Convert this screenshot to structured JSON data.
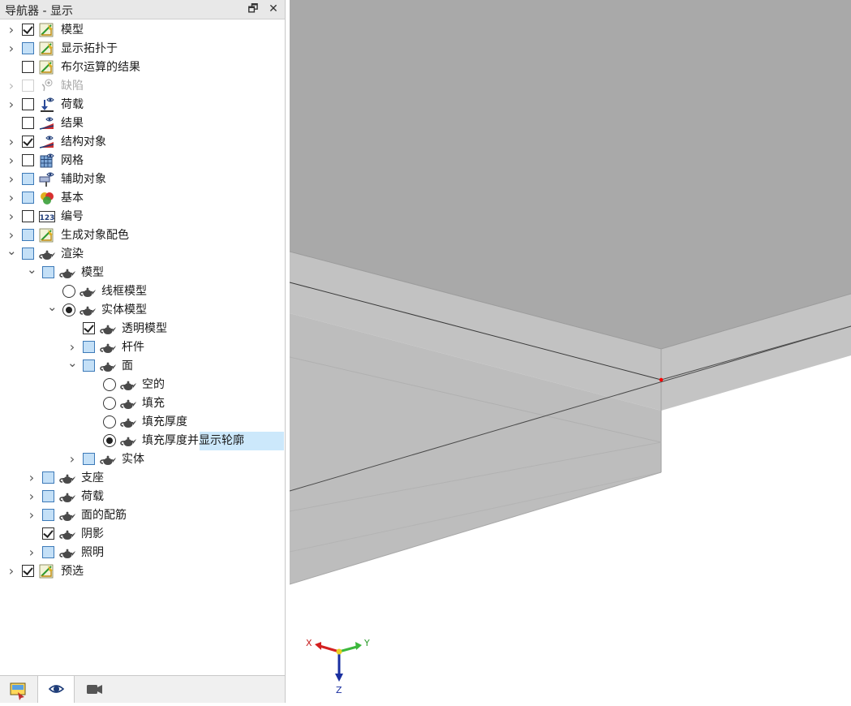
{
  "navigator": {
    "title": "导航器 - 显示",
    "pin_symbol": "🗗",
    "close_symbol": "✕"
  },
  "tree": [
    {
      "label": "模型",
      "depth": 0,
      "expander": "collapsed",
      "control": "checkbox",
      "state": "checked",
      "icon": "model-icon"
    },
    {
      "label": "显示拓扑于",
      "depth": 0,
      "expander": "collapsed",
      "control": "checkbox",
      "state": "partial",
      "icon": "model-icon"
    },
    {
      "label": "布尔运算的结果",
      "depth": 0,
      "expander": "none",
      "control": "checkbox",
      "state": "unchecked",
      "icon": "model-icon"
    },
    {
      "label": "缺陷",
      "depth": 0,
      "expander": "collapsed",
      "control": "checkbox",
      "state": "disabled",
      "icon": "imperfection-icon"
    },
    {
      "label": "荷载",
      "depth": 0,
      "expander": "collapsed",
      "control": "checkbox",
      "state": "unchecked",
      "icon": "load-icon"
    },
    {
      "label": "结果",
      "depth": 0,
      "expander": "none",
      "control": "checkbox",
      "state": "unchecked",
      "icon": "result-icon"
    },
    {
      "label": "结构对象",
      "depth": 0,
      "expander": "collapsed",
      "control": "checkbox",
      "state": "checked",
      "icon": "result-icon"
    },
    {
      "label": "网格",
      "depth": 0,
      "expander": "collapsed",
      "control": "checkbox",
      "state": "unchecked",
      "icon": "grid-icon"
    },
    {
      "label": "辅助对象",
      "depth": 0,
      "expander": "collapsed",
      "control": "checkbox",
      "state": "partial",
      "icon": "guide-object-icon"
    },
    {
      "label": "基本",
      "depth": 0,
      "expander": "collapsed",
      "control": "checkbox",
      "state": "partial",
      "icon": "basic-icon"
    },
    {
      "label": "编号",
      "depth": 0,
      "expander": "collapsed",
      "control": "checkbox",
      "state": "unchecked",
      "icon": "numbering-icon"
    },
    {
      "label": "生成对象配色",
      "depth": 0,
      "expander": "collapsed",
      "control": "checkbox",
      "state": "partial",
      "icon": "model-icon"
    },
    {
      "label": "渲染",
      "depth": 0,
      "expander": "expanded",
      "control": "checkbox",
      "state": "partial",
      "icon": "teapot-icon"
    },
    {
      "label": "模型",
      "depth": 1,
      "expander": "expanded",
      "control": "checkbox",
      "state": "partial",
      "icon": "teapot-icon"
    },
    {
      "label": "线框模型",
      "depth": 2,
      "expander": "none",
      "control": "radio",
      "state": "off",
      "icon": "teapot-icon"
    },
    {
      "label": "实体模型",
      "depth": 2,
      "expander": "expanded",
      "control": "radio",
      "state": "on",
      "icon": "teapot-icon"
    },
    {
      "label": "透明模型",
      "depth": 3,
      "expander": "none",
      "control": "checkbox",
      "state": "checked",
      "icon": "teapot-icon"
    },
    {
      "label": "杆件",
      "depth": 3,
      "expander": "collapsed",
      "control": "checkbox",
      "state": "partial",
      "icon": "teapot-icon"
    },
    {
      "label": "面",
      "depth": 3,
      "expander": "expanded",
      "control": "checkbox",
      "state": "partial",
      "icon": "teapot-icon"
    },
    {
      "label": "空的",
      "depth": 4,
      "expander": "none",
      "control": "radio",
      "state": "off",
      "icon": "teapot-icon"
    },
    {
      "label": "填充",
      "depth": 4,
      "expander": "none",
      "control": "radio",
      "state": "off",
      "icon": "teapot-icon"
    },
    {
      "label": "填充厚度",
      "depth": 4,
      "expander": "none",
      "control": "radio",
      "state": "off",
      "icon": "teapot-icon"
    },
    {
      "label": "填充厚度并显示轮廓",
      "depth": 4,
      "expander": "none",
      "control": "radio",
      "state": "on",
      "icon": "teapot-icon",
      "selected": true
    },
    {
      "label": "实体",
      "depth": 3,
      "expander": "collapsed",
      "control": "checkbox",
      "state": "partial",
      "icon": "teapot-icon"
    },
    {
      "label": "支座",
      "depth": 1,
      "expander": "collapsed",
      "control": "checkbox",
      "state": "partial",
      "icon": "teapot-icon"
    },
    {
      "label": "荷载",
      "depth": 1,
      "expander": "collapsed",
      "control": "checkbox",
      "state": "partial",
      "icon": "teapot-icon"
    },
    {
      "label": "面的配筋",
      "depth": 1,
      "expander": "collapsed",
      "control": "checkbox",
      "state": "partial",
      "icon": "teapot-icon"
    },
    {
      "label": "阴影",
      "depth": 1,
      "expander": "none",
      "control": "checkbox",
      "state": "checked",
      "icon": "teapot-icon"
    },
    {
      "label": "照明",
      "depth": 1,
      "expander": "collapsed",
      "control": "checkbox",
      "state": "partial",
      "icon": "teapot-icon"
    },
    {
      "label": "预选",
      "depth": 0,
      "expander": "collapsed",
      "control": "checkbox",
      "state": "checked",
      "icon": "model-icon"
    }
  ],
  "numbering_icon_text": "123",
  "tabs": [
    {
      "name": "tab-data",
      "icon": "data-navigator-icon",
      "active": false
    },
    {
      "name": "tab-display",
      "icon": "eye-icon",
      "active": true
    },
    {
      "name": "tab-views",
      "icon": "camera-icon",
      "active": false
    }
  ],
  "axes": {
    "x": "X",
    "y": "Y",
    "z": "Z"
  },
  "colors": {
    "partial_fill": "#c4e0f7",
    "selection": "#cce8fb",
    "solid_top": "#a9a9a9",
    "axis_x": "#d42020",
    "axis_y": "#3cb83c",
    "axis_z": "#1a2fa0",
    "node": "#ff0000"
  }
}
